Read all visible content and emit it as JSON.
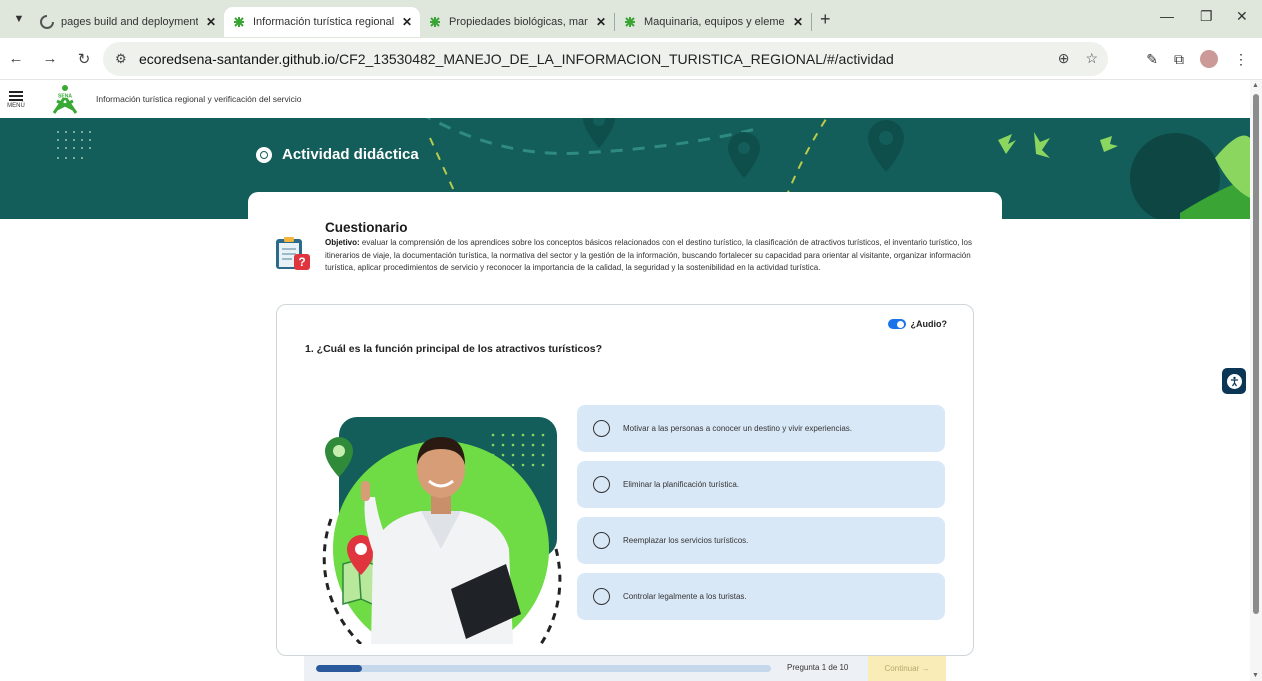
{
  "browser": {
    "tabs": [
      {
        "title": "pages build and deployment · ECC",
        "active": false,
        "favicon": "github-actions-icon"
      },
      {
        "title": "Información turística regional y ve",
        "active": true,
        "favicon": "sena-icon"
      },
      {
        "title": "Propiedades biológicas, manejo y",
        "active": false,
        "favicon": "sena-icon"
      },
      {
        "title": "Maquinaria, equipos y elementos",
        "active": false,
        "favicon": "sena-icon"
      }
    ],
    "url_host": "ecoredsena-santander.github.io",
    "url_path": "/CF2_13530482_MANEJO_DE_LA_INFORMACION_TURISTICA_REGIONAL/#/actividad"
  },
  "site": {
    "menu_label": "MENÚ",
    "title": "Información turística regional y verificación del servicio",
    "logo_text": "SENA"
  },
  "banner": {
    "title": "Actividad didáctica"
  },
  "quiz": {
    "heading": "Cuestionario",
    "objective_label": "Objetivo:",
    "objective_text": " evaluar la comprensión de los aprendices sobre los conceptos básicos relacionados con el destino turístico, la clasificación de atractivos turísticos, el inventario turístico, los itinerarios de viaje, la documentación turística, la normativa del sector y la gestión de la información, buscando fortalecer su capacidad para orientar al visitante, organizar información turística, aplicar procedimientos de servicio y reconocer la importancia de la calidad, la seguridad y la sostenibilidad en la actividad turística.",
    "audio_label": "¿Audio?",
    "audio_on": true,
    "question": "1. ¿Cuál es la función principal de los atractivos turísticos?",
    "options": [
      "Motivar a las personas a conocer un destino y vivir experiencias.",
      "Eliminar la planificación turística.",
      "Reemplazar los servicios turísticos.",
      "Controlar legalmente a los turistas."
    ],
    "progress": {
      "label": "Pregunta 1 de 10",
      "current": 1,
      "total": 10
    },
    "continue_label": "Continuar →"
  },
  "colors": {
    "banner": "#135e5a",
    "option_bg": "#d9e8f7",
    "progress_fill": "#2a5a9c",
    "continue_bg": "#f9ecb7",
    "accent_green": "#6fdc45"
  }
}
